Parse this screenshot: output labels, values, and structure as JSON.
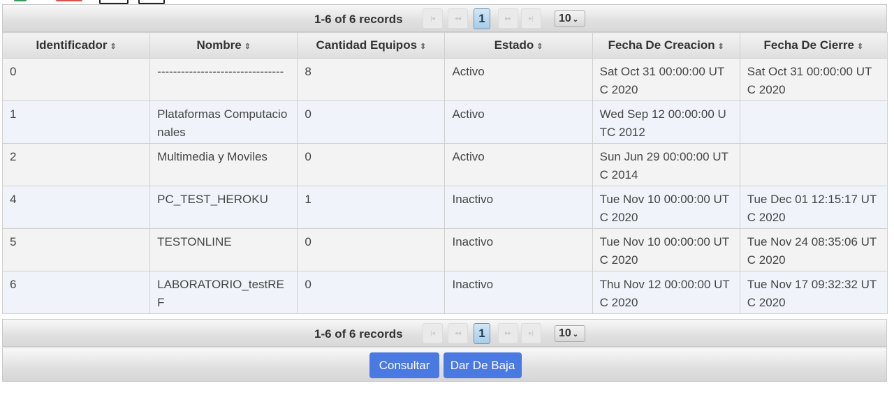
{
  "paginator": {
    "summary": "1-6 of 6 records",
    "first_icon": "first-page-icon",
    "prev_icon": "prev-page-icon",
    "current_page": "1",
    "next_icon": "next-page-icon",
    "last_icon": "last-page-icon",
    "rows_per_page": "10"
  },
  "table": {
    "columns": [
      "Identificador",
      "Nombre",
      "Cantidad Equipos",
      "Estado",
      "Fecha De Creacion",
      "Fecha De Cierre"
    ],
    "rows": [
      [
        "0",
        "--------------------------------",
        "8",
        "Activo",
        "Sat Oct 31 00:00:00 UTC 2020",
        "Sat Oct 31 00:00:00 UTC 2020"
      ],
      [
        "1",
        "Plataformas Computacionales",
        "0",
        "Activo",
        "Wed Sep 12 00:00:00 UTC 2012",
        ""
      ],
      [
        "2",
        "Multimedia y Moviles",
        "0",
        "Activo",
        "Sun Jun 29 00:00:00 UTC 2014",
        ""
      ],
      [
        "4",
        "PC_TEST_HEROKU",
        "1",
        "Inactivo",
        "Tue Nov 10 00:00:00 UTC 2020",
        "Tue Dec 01 12:15:17 UTC 2020"
      ],
      [
        "5",
        "TESTONLINE",
        "0",
        "Inactivo",
        "Tue Nov 10 00:00:00 UTC 2020",
        "Tue Nov 24 08:35:06 UTC 2020"
      ],
      [
        "6",
        "LABORATORIO_testREF",
        "0",
        "Inactivo",
        "Thu Nov 12 00:00:00 UTC 2020",
        "Tue Nov 17 09:32:32 UTC 2020"
      ]
    ]
  },
  "actions": {
    "consultar_label": "Consultar",
    "dar_de_baja_label": "Dar De Baja"
  },
  "colors": {
    "button_blue": "#4a79e2",
    "active_page_blue": "#a9cce8",
    "row_alt": "#f0f4fa"
  }
}
